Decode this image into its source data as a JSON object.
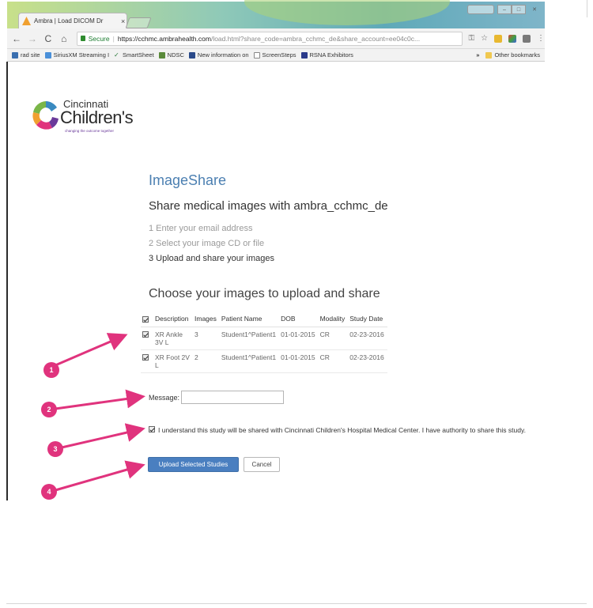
{
  "browser": {
    "tab_title": "Ambra | Load DICOM Dr",
    "tab_close": "×",
    "window_user": "",
    "window_min": "–",
    "window_max": "□",
    "window_close": "✕",
    "nav_back": "←",
    "nav_forward": "→",
    "nav_reload": "C",
    "nav_home": "⌂",
    "secure_label": "Secure",
    "url_host": "https://cchmc.ambrahealth.com",
    "url_rest": "/load.html?share_code=ambra_cchmc_de&share_account=ee04c0c...",
    "key_icon": "⚿",
    "star_icon": "☆",
    "menu_icon": "⋮",
    "bookmarks": [
      {
        "label": "rad site",
        "icon_color": "#3a6fb0"
      },
      {
        "label": "SiriusXM Streaming I",
        "icon_color": "#4a90d9"
      },
      {
        "label": "SmartSheet",
        "icon_color": "#2a7a3a"
      },
      {
        "label": "NDSC",
        "icon_color": "#5a8a3a"
      },
      {
        "label": "New information on",
        "icon_color": "#2a4a8a"
      },
      {
        "label": "ScreenSteps",
        "icon_color": "#888888"
      },
      {
        "label": "RSNA Exhibitors",
        "icon_color": "#2a3a8a"
      }
    ],
    "bookmarks_more": "»",
    "other_bookmarks": "Other bookmarks"
  },
  "logo": {
    "line1": "Cincinnati",
    "line2": "Children's",
    "tagline": "changing the outcome together"
  },
  "page": {
    "title": "ImageShare",
    "subtitle": "Share medical images with ambra_cchmc_de",
    "steps": [
      "1 Enter your email address",
      "2 Select your image CD or file",
      "3 Upload and share your images"
    ],
    "section_title": "Choose your images to upload and share"
  },
  "table": {
    "headers": [
      "Description",
      "Images",
      "Patient Name",
      "DOB",
      "Modality",
      "Study Date"
    ],
    "rows": [
      {
        "checked": true,
        "description": "XR Ankle 3V L",
        "images": "3",
        "patient": "Student1^Patient1",
        "dob": "01-01-2015",
        "modality": "CR",
        "date": "02-23-2016"
      },
      {
        "checked": true,
        "description": "XR Foot 2V L",
        "images": "2",
        "patient": "Student1^Patient1",
        "dob": "01-01-2015",
        "modality": "CR",
        "date": "02-23-2016"
      }
    ]
  },
  "form": {
    "message_label": "Message:",
    "message_value": "",
    "agree_checked": true,
    "agree_text": "I understand this study will be shared with Cincinnati Children's Hospital Medical Center. I have authority to share this study.",
    "upload_button": "Upload Selected Studies",
    "cancel_button": "Cancel"
  },
  "annotations": {
    "color": "#e0337d",
    "badges": [
      "1",
      "2",
      "3",
      "4"
    ]
  }
}
